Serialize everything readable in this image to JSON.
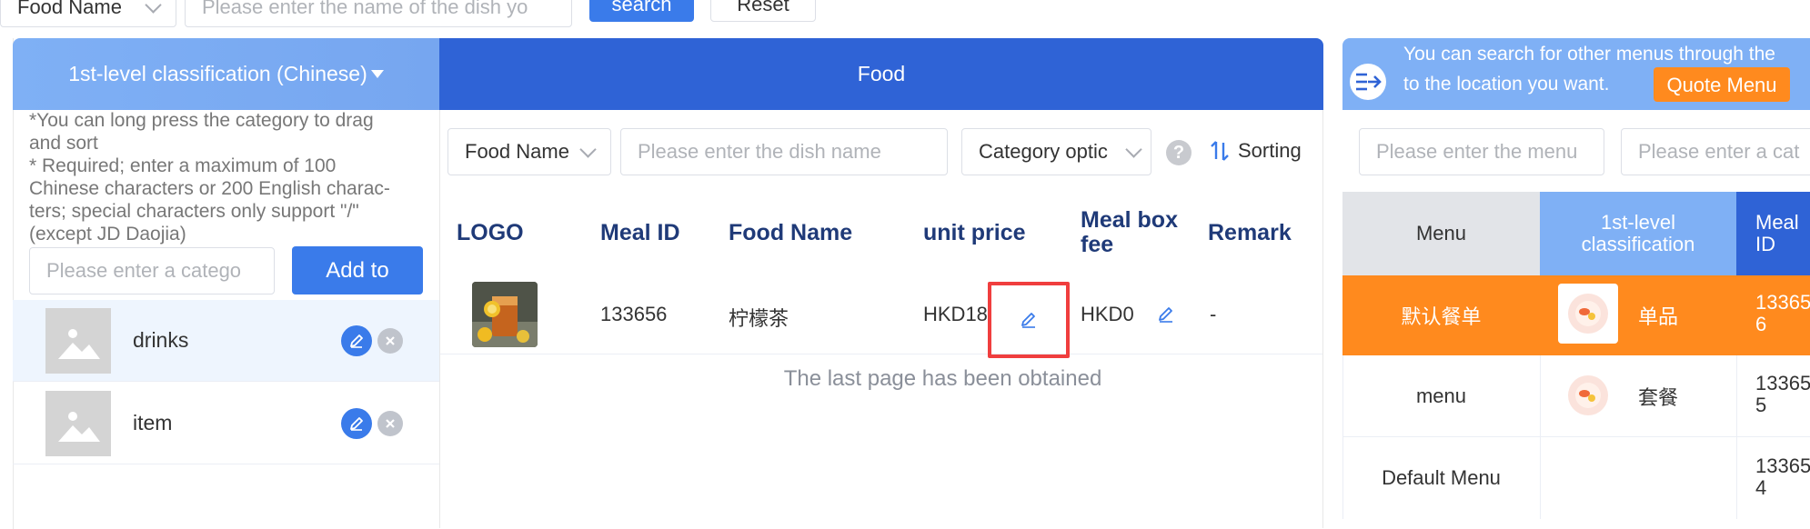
{
  "top_filter": {
    "field_select": "Food Name",
    "search_placeholder": "Please enter the name of the dish yo",
    "search_label": "search",
    "reset_label": "Reset"
  },
  "left": {
    "header": "1st-level classification (Chinese)",
    "note_lines": [
      "*You can long press the category to drag",
      "and sort",
      "* Required; enter a maximum of 100",
      "Chinese characters or 200 English charac-",
      "ters; special characters only support \"/\"",
      "(except JD Daojia)"
    ],
    "category_placeholder": "Please enter a catego",
    "add_label": "Add to",
    "categories": [
      {
        "label": "drinks"
      },
      {
        "label": "item"
      }
    ]
  },
  "middle": {
    "header": "Food",
    "filter_select": "Food Name",
    "dish_placeholder": "Please enter the dish name",
    "category_select": "Category optic",
    "help_glyph": "?",
    "sorting_label": "Sorting",
    "columns": {
      "logo": "LOGO",
      "meal_id": "Meal ID",
      "food_name": "Food Name",
      "unit_price": "unit price",
      "box_fee_1": "Meal box",
      "box_fee_2": "fee",
      "remark": "Remark"
    },
    "row": {
      "meal_id": "133656",
      "food_name": "柠檬茶",
      "unit_price": "HKD18",
      "box_fee": "HKD0",
      "remark": "-"
    },
    "footer": "The last page has been obtained"
  },
  "right": {
    "header_line1": "You can search for other menus through the",
    "header_line2": "to the location you want.",
    "quote_label": "Quote Menu",
    "menu_placeholder": "Please enter the menu",
    "category_placeholder": "Please enter a cat",
    "columns": {
      "menu": "Menu",
      "classification_1": "1st-level",
      "classification_2": "classification",
      "meal_id_1": "Meal",
      "meal_id_2": "ID"
    },
    "rows": [
      {
        "menu": "默认餐单",
        "category": "单品",
        "id_1": "13365",
        "id_2": "6"
      },
      {
        "menu": "menu",
        "category": "套餐",
        "id_1": "13365",
        "id_2": "5"
      },
      {
        "menu": "Default Menu",
        "category": "",
        "id_1": "13365",
        "id_2": "4"
      }
    ]
  },
  "colors": {
    "primary": "#3a7bea",
    "header_dark": "#2f63d6",
    "header_light": "#7fb0f5",
    "highlight_orange": "#ff8a1e",
    "selected_row": "#eef5fe",
    "focus_box": "#f03e3e"
  }
}
